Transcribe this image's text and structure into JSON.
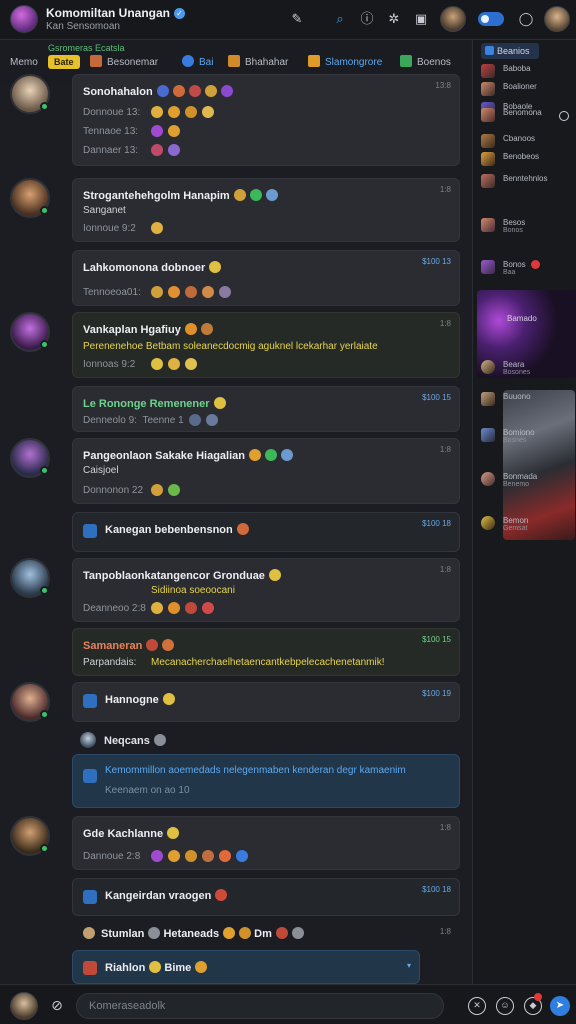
{
  "header": {
    "title": "Komomiltan Unangan",
    "subtitle": "Kan Sensomoan"
  },
  "categories": {
    "caption": "Gsromeras Ecatsla",
    "menu_label": "Memo",
    "hot_badge": "Bate",
    "items": [
      {
        "label": "Besonemar",
        "color": "#c46a3a"
      },
      {
        "label": "Bai",
        "color": "#3a7be0"
      },
      {
        "label": "Bhahahar",
        "color": "#d08a2a"
      },
      {
        "label": "Slamongrore",
        "color": "#e09a2a"
      },
      {
        "label": "Boenos",
        "color": "#3aa85a"
      }
    ]
  },
  "rail": {
    "head": "Beanios",
    "items": [
      {
        "label": "Baboba",
        "sub": ""
      },
      {
        "label": "Boalioner",
        "sub": ""
      },
      {
        "label": "Bobaole",
        "sub": ""
      },
      {
        "label": "Benomona",
        "sub": ""
      },
      {
        "label": "Cbanoos",
        "sub": ""
      },
      {
        "label": "Benobeos",
        "sub": ""
      },
      {
        "label": "Benntehnlos",
        "sub": ""
      },
      {
        "label": "Besos",
        "sub": "Bonos"
      },
      {
        "label": "Bonos",
        "sub": "Baa"
      }
    ],
    "card_caption": "Bamado",
    "lower_items": [
      {
        "label": "Beara",
        "sub": "Bosones"
      },
      {
        "label": "Buuono",
        "sub": ""
      },
      {
        "label": "Bomiono",
        "sub": "Bosnes"
      },
      {
        "label": "Bonmada",
        "sub": "Benemo"
      },
      {
        "label": "Bemon",
        "sub": "Gemsat"
      }
    ]
  },
  "messages": [
    {
      "title": "Sonohahalon",
      "meta": [
        "Donnoue 13:",
        "Tennaoe 13:",
        "Dannaer 13:"
      ],
      "time": "13:8"
    },
    {
      "title": "Strogantehehgolm Hanapim",
      "sub": "Sanganet",
      "meta": [
        "Ionnoue 9:2"
      ],
      "time": "1:8"
    },
    {
      "title": "Lahkomonona dobnoer",
      "meta": [
        "Tennoeoa01:"
      ],
      "time": "$100 13"
    },
    {
      "title": "Vankaplan Hgafiuy",
      "sub": "Perenenehoe Betbam soleanecdocmig aguknel lcekarhar yerlaiate",
      "meta": [
        "Ionnoas 9:2"
      ],
      "time": "1:8"
    },
    {
      "title": "Le Rononge Remenener",
      "meta": [
        "Denneolo 9:",
        "Teenne 1"
      ],
      "time": "$100 15"
    },
    {
      "title": "Pangeonlaon Sakake Hiagalian",
      "sub": "Caisjoel",
      "meta": [
        "Donnonon 22"
      ],
      "time": "1:8"
    },
    {
      "title": "Kanegan bebenbensnon",
      "time": "$100 18"
    },
    {
      "title": "Tanpoblaonkatangencor Gronduae",
      "sub": "Sidiinoa soeoocani",
      "meta": [
        "Deanneoo 2:8"
      ],
      "time": "1:8"
    },
    {
      "title": "Samaneran",
      "sub": "Parpandais:",
      "note": "Mecanacherchaelhetaencantkebpelecachenetanmik!",
      "time": "$100 15"
    },
    {
      "title": "Hannogne",
      "time": "$100 19"
    },
    {
      "title": "Neqcans",
      "time": ""
    },
    {
      "title": "Kemommillon aoemedads nelegenmaben kenderan degr kamaenim",
      "meta": [
        "Keenaem on ao 10"
      ],
      "time": ""
    },
    {
      "title": "Gde Kachlanne",
      "meta": [
        "Dannoue 2:8"
      ],
      "time": "1:8"
    },
    {
      "title": "Kangeirdan vraogen",
      "time": "$100 18"
    },
    {
      "title": "Stumlan",
      "title2": "Hetaneads",
      "title3": "Dm",
      "time": "1:8"
    },
    {
      "title": "Riahlon",
      "title2": "Bime",
      "time": ""
    }
  ],
  "composer": {
    "placeholder": "Komeraseadolk"
  }
}
